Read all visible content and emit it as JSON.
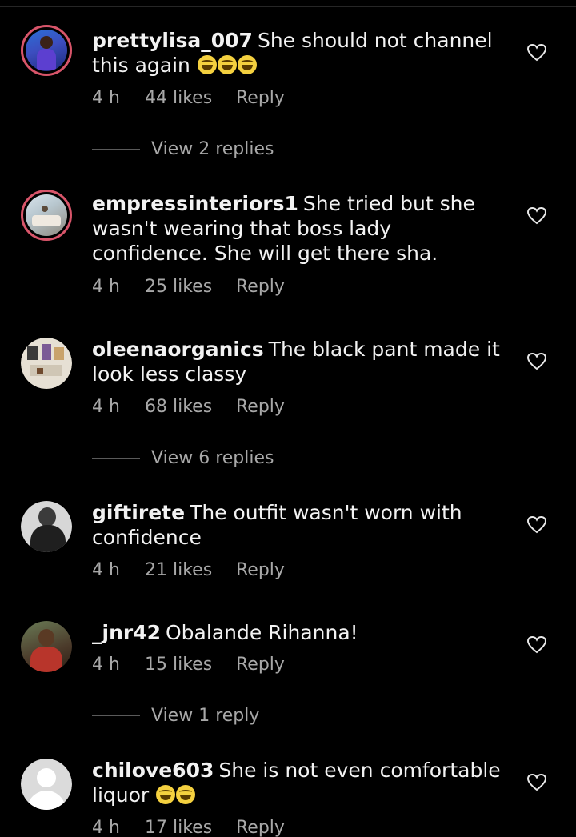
{
  "comments": [
    {
      "username": "prettylisa_007",
      "text": "She should not channel this again",
      "emoji_count": 3,
      "time": "4 h",
      "likes": "44 likes",
      "reply": "Reply",
      "view_replies": "View 2 replies"
    },
    {
      "username": "empressinteriors1",
      "text": "She tried but she wasn't wearing that boss lady confidence. She will get there sha.",
      "time": "4 h",
      "likes": "25 likes",
      "reply": "Reply"
    },
    {
      "username": "oleenaorganics",
      "text": "The black pant made it look less classy",
      "time": "4 h",
      "likes": "68 likes",
      "reply": "Reply",
      "view_replies": "View 6 replies"
    },
    {
      "username": "giftirete",
      "text": "The outfit wasn't worn with confidence",
      "time": "4 h",
      "likes": "21 likes",
      "reply": "Reply"
    },
    {
      "username": "_jnr42",
      "text": "Obalande Rihanna!",
      "time": "4 h",
      "likes": "15 likes",
      "reply": "Reply",
      "view_replies": "View 1 reply"
    },
    {
      "username": "chilove603",
      "text": "She is not even comfortable liquor",
      "emoji_count": 2,
      "time": "4 h",
      "likes": "17 likes",
      "reply": "Reply"
    }
  ],
  "colors": {
    "background": "#000000",
    "text": "#f2f2f2",
    "secondary": "#a8a8a8",
    "story_ring": "#d8556a"
  },
  "icons": {
    "like": "heart-outline-icon",
    "emoji": "grinning-sweat-face-emoji"
  }
}
